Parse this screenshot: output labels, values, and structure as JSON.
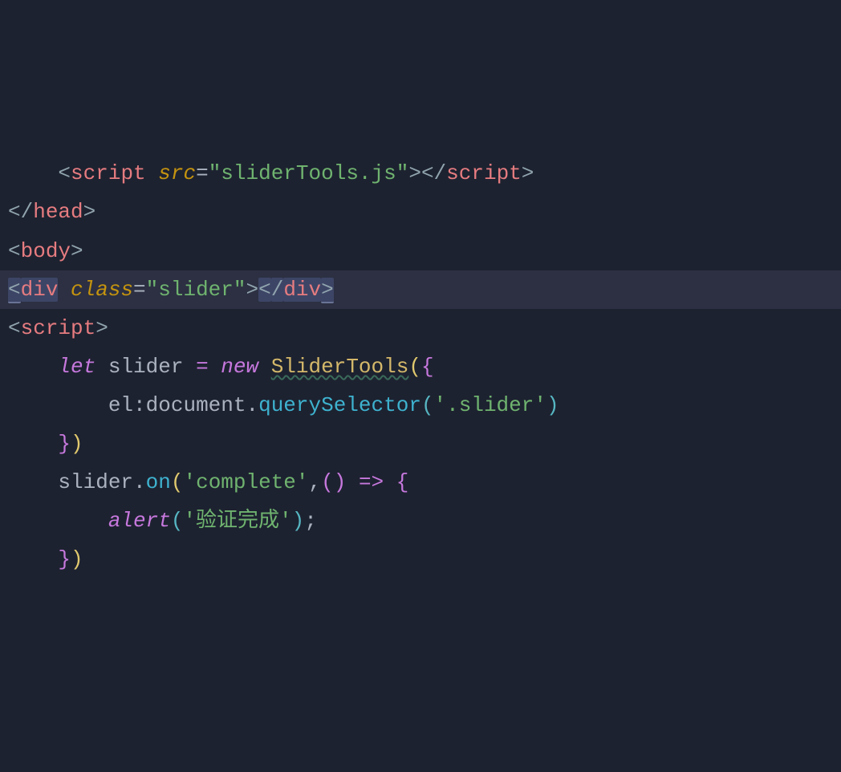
{
  "code": {
    "lines": [
      {
        "indent": "    ",
        "tokens": [
          {
            "text": "<",
            "class": "tag-bracket"
          },
          {
            "text": "script",
            "class": "tag-name"
          },
          {
            "text": " ",
            "class": ""
          },
          {
            "text": "src",
            "class": "attr-name"
          },
          {
            "text": "=",
            "class": "attr-equals"
          },
          {
            "text": "\"sliderTools.js\"",
            "class": "string"
          },
          {
            "text": ">",
            "class": "tag-bracket"
          },
          {
            "text": "<",
            "class": "tag-bracket"
          },
          {
            "text": "/",
            "class": "slash"
          },
          {
            "text": "script",
            "class": "tag-name"
          },
          {
            "text": ">",
            "class": "tag-bracket"
          }
        ]
      },
      {
        "indent": "",
        "tokens": [
          {
            "text": "<",
            "class": "tag-bracket"
          },
          {
            "text": "/",
            "class": "slash"
          },
          {
            "text": "head",
            "class": "tag-name"
          },
          {
            "text": ">",
            "class": "tag-bracket"
          }
        ]
      },
      {
        "indent": "",
        "tokens": [
          {
            "text": "<",
            "class": "tag-bracket"
          },
          {
            "text": "body",
            "class": "tag-name"
          },
          {
            "text": ">",
            "class": "tag-bracket"
          }
        ]
      },
      {
        "current": true,
        "indent": "",
        "tokens": [
          {
            "text": "<",
            "class": "tag-bracket highlight-match highlight-underline"
          },
          {
            "text": "div",
            "class": "tag-name highlight-match"
          },
          {
            "text": " ",
            "class": ""
          },
          {
            "text": "class",
            "class": "attr-name"
          },
          {
            "text": "=",
            "class": "attr-equals"
          },
          {
            "text": "\"slider\"",
            "class": "string"
          },
          {
            "text": ">",
            "class": "tag-bracket"
          },
          {
            "text": "<",
            "class": "tag-bracket highlight-match"
          },
          {
            "text": "/",
            "class": "slash highlight-match"
          },
          {
            "text": "div",
            "class": "tag-name highlight-match"
          },
          {
            "text": ">",
            "class": "tag-bracket highlight-match highlight-underline"
          }
        ]
      },
      {
        "indent": "",
        "tokens": [
          {
            "text": "<",
            "class": "tag-bracket"
          },
          {
            "text": "script",
            "class": "tag-name"
          },
          {
            "text": ">",
            "class": "tag-bracket"
          }
        ]
      },
      {
        "indent": "    ",
        "tokens": [
          {
            "text": "let",
            "class": "keyword"
          },
          {
            "text": " slider ",
            "class": "variable"
          },
          {
            "text": "=",
            "class": "operator"
          },
          {
            "text": " ",
            "class": ""
          },
          {
            "text": "new",
            "class": "keyword"
          },
          {
            "text": " ",
            "class": ""
          },
          {
            "text": "SliderTools",
            "class": "class-name class-name-wavy"
          },
          {
            "text": "(",
            "class": "paren-yellow"
          },
          {
            "text": "{",
            "class": "brace-purple"
          }
        ]
      },
      {
        "indent": "        ",
        "tokens": [
          {
            "text": "el",
            "class": "property"
          },
          {
            "text": ":",
            "class": "punct"
          },
          {
            "text": "document",
            "class": "variable"
          },
          {
            "text": ".",
            "class": "punct"
          },
          {
            "text": "querySelector",
            "class": "method"
          },
          {
            "text": "(",
            "class": "paren-blue"
          },
          {
            "text": "'.slider'",
            "class": "string"
          },
          {
            "text": ")",
            "class": "paren-blue"
          }
        ]
      },
      {
        "indent": "    ",
        "tokens": [
          {
            "text": "}",
            "class": "brace-purple"
          },
          {
            "text": ")",
            "class": "paren-yellow"
          }
        ]
      },
      {
        "indent": "    ",
        "tokens": [
          {
            "text": "slider",
            "class": "variable"
          },
          {
            "text": ".",
            "class": "punct"
          },
          {
            "text": "on",
            "class": "method"
          },
          {
            "text": "(",
            "class": "paren-yellow"
          },
          {
            "text": "'complete'",
            "class": "string"
          },
          {
            "text": ",",
            "class": "punct"
          },
          {
            "text": "(",
            "class": "paren-purple"
          },
          {
            "text": ")",
            "class": "paren-purple"
          },
          {
            "text": " ",
            "class": ""
          },
          {
            "text": "=>",
            "class": "arrow"
          },
          {
            "text": " ",
            "class": ""
          },
          {
            "text": "{",
            "class": "brace-purple"
          }
        ]
      },
      {
        "indent": "        ",
        "tokens": [
          {
            "text": "alert",
            "class": "builtin"
          },
          {
            "text": "(",
            "class": "paren-blue"
          },
          {
            "text": "'验证完成'",
            "class": "string"
          },
          {
            "text": ")",
            "class": "paren-blue"
          },
          {
            "text": ";",
            "class": "punct"
          }
        ]
      },
      {
        "indent": "    ",
        "tokens": [
          {
            "text": "}",
            "class": "brace-purple"
          },
          {
            "text": ")",
            "class": "paren-yellow"
          }
        ]
      }
    ]
  }
}
